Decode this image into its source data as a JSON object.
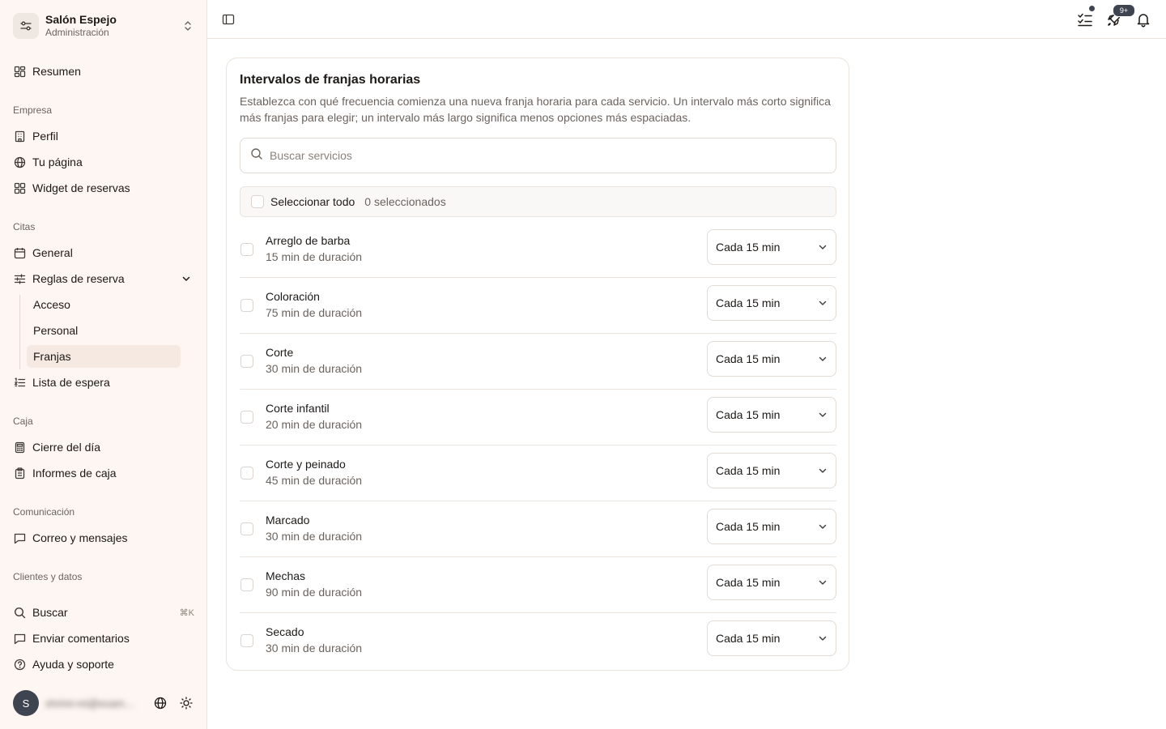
{
  "org": {
    "name": "Salón Espejo",
    "subtitle": "Administración",
    "icon": "settings-sliders-icon"
  },
  "nav": {
    "summary": "Resumen",
    "sections": {
      "company": "Empresa",
      "appointments": "Citas",
      "cash": "Caja",
      "communication": "Comunicación",
      "clients": "Clientes y datos"
    },
    "profile": "Perfil",
    "your_page": "Tu página",
    "booking_widget": "Widget de reservas",
    "general": "General",
    "booking_rules": "Reglas de reserva",
    "booking_rules_children": [
      "Acceso",
      "Personal",
      "Franjas"
    ],
    "active_child": "Franjas",
    "waitlist": "Lista de espera",
    "day_close": "Cierre del día",
    "cash_reports": "Informes de caja",
    "mail_messages": "Correo y mensajes",
    "search": "Buscar",
    "search_shortcut": "⌘K",
    "feedback": "Enviar comentarios",
    "help": "Ayuda y soporte"
  },
  "user": {
    "initial": "S",
    "email": "shrimi-mi@exam…"
  },
  "topbar": {
    "notifications_badge": "9+"
  },
  "card": {
    "title": "Intervalos de franjas horarias",
    "description": "Establezca con qué frecuencia comienza una nueva franja horaria para cada servicio. Un intervalo más corto significa más franjas para elegir; un intervalo más largo significa menos opciones más espaciadas.",
    "search_placeholder": "Buscar servicios",
    "select_all_label": "Seleccionar todo",
    "selected_count": "0 seleccionados",
    "services": [
      {
        "name": "Arreglo de barba",
        "duration": "15 min de duración",
        "interval": "Cada 15 min"
      },
      {
        "name": "Coloración",
        "duration": "75 min de duración",
        "interval": "Cada 15 min"
      },
      {
        "name": "Corte",
        "duration": "30 min de duración",
        "interval": "Cada 15 min"
      },
      {
        "name": "Corte infantil",
        "duration": "20 min de duración",
        "interval": "Cada 15 min"
      },
      {
        "name": "Corte y peinado",
        "duration": "45 min de duración",
        "interval": "Cada 15 min"
      },
      {
        "name": "Marcado",
        "duration": "30 min de duración",
        "interval": "Cada 15 min"
      },
      {
        "name": "Mechas",
        "duration": "90 min de duración",
        "interval": "Cada 15 min"
      },
      {
        "name": "Secado",
        "duration": "30 min de duración",
        "interval": "Cada 15 min"
      }
    ]
  },
  "colors": {
    "sidebar_bg": "#fdf6f2",
    "active_bg": "#f5e9e1",
    "badge": "#3f4451",
    "border": "#ece4de"
  }
}
